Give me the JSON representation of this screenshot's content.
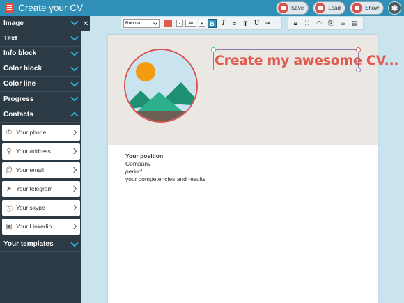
{
  "app": {
    "title": "Create your CV"
  },
  "actions": {
    "save": "Save",
    "load": "Load",
    "show": "Show"
  },
  "sidebar": {
    "sections": [
      {
        "label": "Image",
        "expanded": false
      },
      {
        "label": "Text",
        "expanded": false
      },
      {
        "label": "Info block",
        "expanded": false
      },
      {
        "label": "Color block",
        "expanded": false
      },
      {
        "label": "Color line",
        "expanded": false
      },
      {
        "label": "Progress",
        "expanded": false
      },
      {
        "label": "Contacts",
        "expanded": true
      }
    ],
    "contacts": [
      {
        "label": "Your phone",
        "icon": "phone-icon"
      },
      {
        "label": "Your address",
        "icon": "location-icon"
      },
      {
        "label": "Your email",
        "icon": "at-icon"
      },
      {
        "label": "Your telegram",
        "icon": "telegram-icon"
      },
      {
        "label": "Your skype",
        "icon": "skype-icon"
      },
      {
        "label": "Your Linkedin",
        "icon": "linkedin-icon"
      }
    ],
    "templates_label": "Your templates"
  },
  "format_toolbar": {
    "font": "Roboto",
    "color": "#e05a4e",
    "size": "40",
    "minus": "-",
    "plus": "+"
  },
  "cv": {
    "title": "Create my awesome CV...",
    "position": "Your position",
    "company": "Company",
    "period": "period",
    "results": "your competencies and results"
  },
  "colors": {
    "topbar": "#2f8fb7",
    "sidebar": "#2b3a45",
    "accent": "#2ea8d6",
    "title_red": "#e05a4e"
  }
}
